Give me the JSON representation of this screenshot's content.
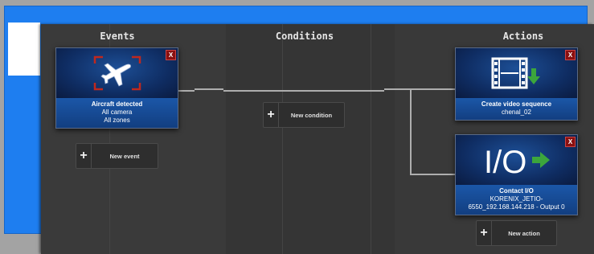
{
  "columns": {
    "events": "Events",
    "conditions": "Conditions",
    "actions": "Actions"
  },
  "events": [
    {
      "title": "Aircraft detected",
      "lines": [
        "All camera",
        "All zones"
      ],
      "icon": "airplane-icon",
      "close": "X"
    }
  ],
  "actions": [
    {
      "title": "Create video sequence",
      "lines": [
        "chenal_02"
      ],
      "icon": "film-icon",
      "close": "X"
    },
    {
      "title": "Contact I/O",
      "lines": [
        "KORENIX_JETIO-",
        "6550_192.168.144.218 - Output 0"
      ],
      "icon": "io-icon",
      "icon_text": "I/O",
      "close": "X"
    }
  ],
  "buttons": {
    "new_event": "New event",
    "new_condition": "New condition",
    "new_action": "New action",
    "plus": "+"
  },
  "colors": {
    "background_window": "#1e7ef0",
    "panel": "#363636",
    "card": "#0f2d63",
    "close": "#8a1010",
    "arrow": "#3ca63c"
  }
}
